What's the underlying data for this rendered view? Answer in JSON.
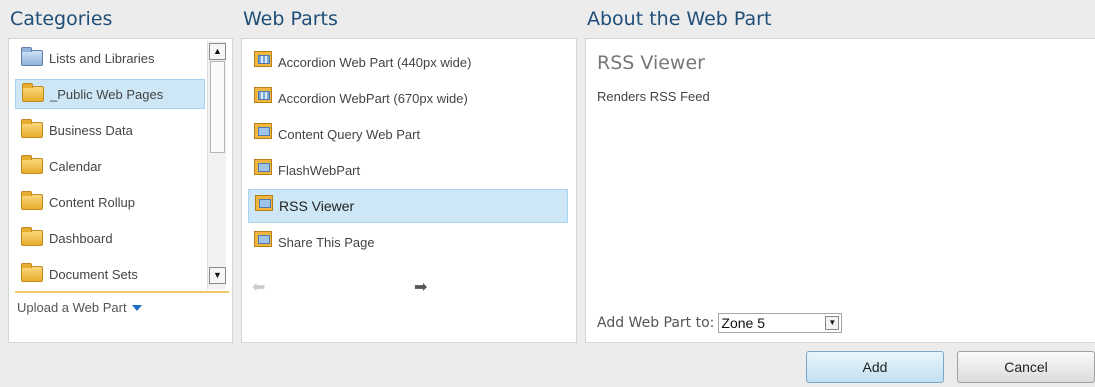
{
  "headings": {
    "categories": "Categories",
    "web_parts": "Web Parts",
    "about": "About the Web Part"
  },
  "categories": {
    "items": [
      {
        "label": "Lists and Libraries",
        "icon": "folder-special-icon",
        "selected": false
      },
      {
        "label": "_Public Web Pages",
        "icon": "folder-icon",
        "selected": true
      },
      {
        "label": "Business Data",
        "icon": "folder-icon",
        "selected": false
      },
      {
        "label": "Calendar",
        "icon": "folder-icon",
        "selected": false
      },
      {
        "label": "Content Rollup",
        "icon": "folder-icon",
        "selected": false
      },
      {
        "label": "Dashboard",
        "icon": "folder-icon",
        "selected": false
      },
      {
        "label": "Document Sets",
        "icon": "folder-icon",
        "selected": false
      }
    ],
    "upload_label": "Upload a Web Part"
  },
  "web_parts": {
    "items": [
      {
        "label": "Accordion Web Part (440px wide)",
        "icon": "web-part-grid-icon",
        "selected": false
      },
      {
        "label": "Accordion WebPart (670px wide)",
        "icon": "web-part-grid-icon",
        "selected": false
      },
      {
        "label": "Content Query Web Part",
        "icon": "web-part-icon",
        "selected": false
      },
      {
        "label": "FlashWebPart",
        "icon": "web-part-icon",
        "selected": false
      },
      {
        "label": "RSS Viewer",
        "icon": "web-part-icon",
        "selected": true
      },
      {
        "label": "Share This Page",
        "icon": "web-part-icon",
        "selected": false
      }
    ],
    "pager": {
      "prev_glyph": "⬅",
      "next_glyph": "➡"
    }
  },
  "about": {
    "title": "RSS Viewer",
    "description": "Renders RSS Feed",
    "add_to_label": "Add Web Part to:",
    "zone_value": "Zone 5"
  },
  "buttons": {
    "add": "Add",
    "cancel": "Cancel"
  },
  "colors": {
    "heading": "#1f4e79",
    "selection": "#cde7f7",
    "background": "#ececec"
  }
}
